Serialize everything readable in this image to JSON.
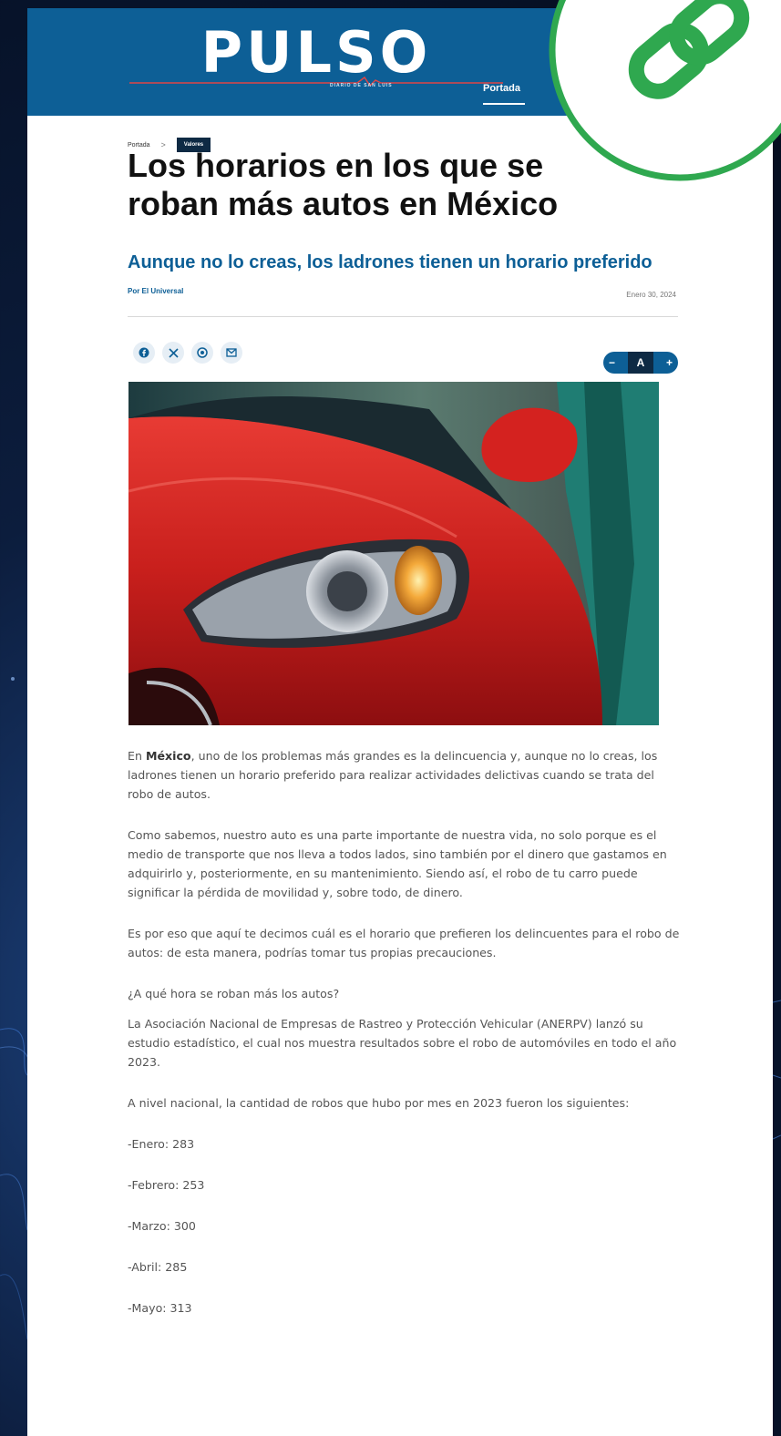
{
  "masthead": {
    "logo_text": "PULSO",
    "logo_subtitle": "DIARIO DE SAN LUIS",
    "nav": [
      {
        "label": "Portada"
      }
    ]
  },
  "breadcrumb": {
    "home": "Portada",
    "separator": ">",
    "section": "Valores"
  },
  "article": {
    "title": "Los horarios en los que se roban más autos en México",
    "subtitle": "Aunque no lo creas, los ladrones tienen un horario preferido",
    "byline": "Por El Universal",
    "date": "Enero 30, 2024",
    "share_icons": [
      "facebook-icon",
      "x-icon",
      "whatsapp-icon",
      "email-icon"
    ],
    "font_controls": {
      "decrease": "−",
      "label": "A",
      "increase": "+"
    },
    "image_alt": "Red car headlight",
    "paragraphs": {
      "p1_pre": "En ",
      "p1_bold": "México",
      "p1_post": ", uno de los problemas más grandes es la delincuencia y, aunque no lo creas, los ladrones tienen un horario preferido para realizar actividades delictivas cuando se trata del robo de autos.",
      "p2": "Como sabemos, nuestro auto es una parte importante de nuestra vida, no solo porque es el medio de transporte que nos lleva a todos lados, sino también por el dinero que gastamos en adquirirlo y, posteriormente, en su mantenimiento. Siendo así, el robo de tu carro puede significar la pérdida de movilidad y, sobre todo, de dinero.",
      "p3": "Es por eso que aquí te decimos cuál es el horario que prefieren los delincuentes para el robo de autos: de esta manera, podrías tomar tus propias precauciones.",
      "p4": "¿A qué hora se roban más los autos?",
      "p5": "La Asociación Nacional de Empresas de Rastreo y Protección Vehicular (ANERPV) lanzó su estudio estadístico, el cual nos muestra resultados sobre el robo de automóviles en todo el año 2023.",
      "p6": "A nivel nacional, la cantidad de robos que hubo por mes en 2023 fueron los siguientes:"
    },
    "months": [
      "-Enero: 283",
      "-Febrero: 253",
      "-Marzo: 300",
      "-Abril: 285",
      "-Mayo: 313"
    ]
  },
  "colors": {
    "brand_blue": "#0d5f96",
    "dark_navy": "#0e2a44",
    "link_green": "#2fa84f"
  },
  "overlay_icon": "link-icon"
}
